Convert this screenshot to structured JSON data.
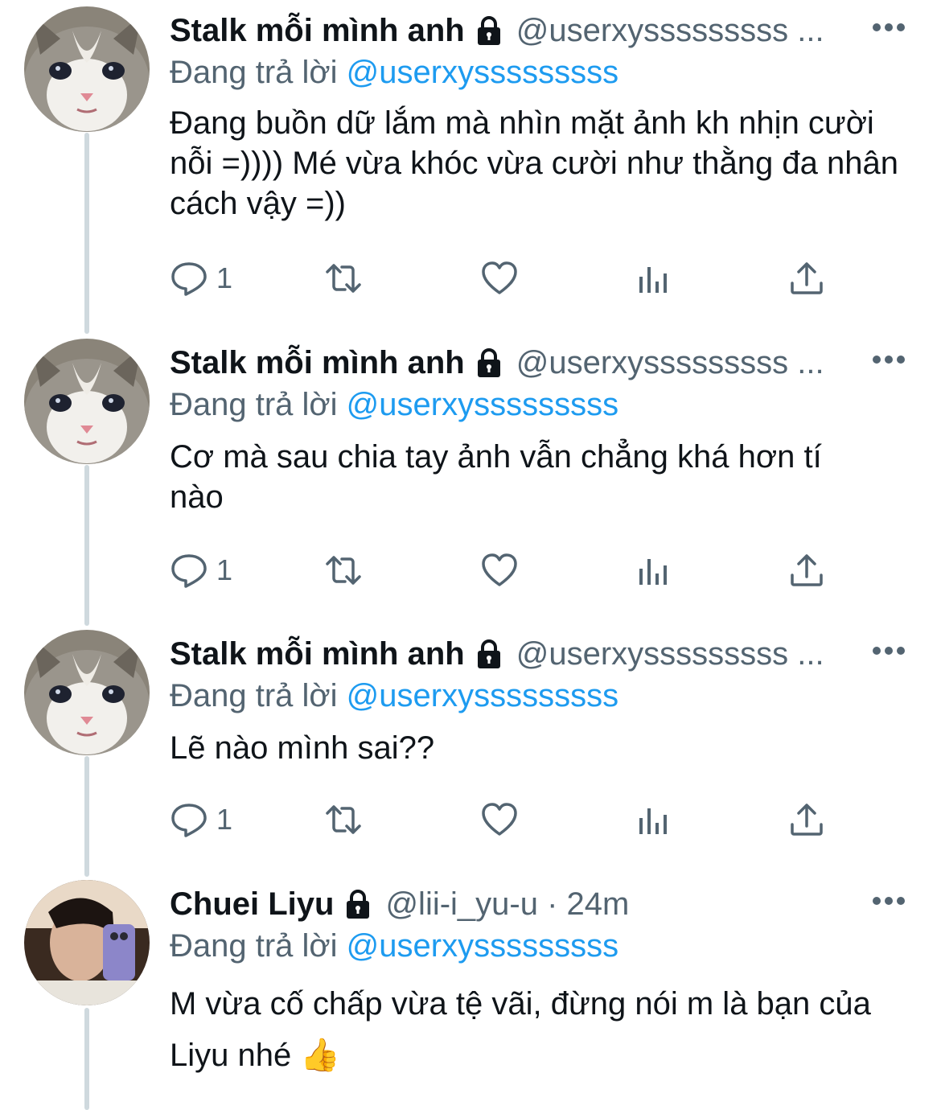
{
  "tweets": [
    {
      "name": "Stalk mỗi mình anh",
      "handle": "@userxysssssssss ...",
      "reply_prefix": "Đang trả lời",
      "reply_mention": "@userxysssssssss",
      "text": "Đang buồn dữ lắm mà nhìn mặt ảnh kh nhịn cười nỗi =)))) Mé vừa khóc vừa cười như thằng đa nhân cách vậy =))",
      "reply_count": "1"
    },
    {
      "name": "Stalk mỗi mình anh",
      "handle": "@userxysssssssss ...",
      "reply_prefix": "Đang trả lời",
      "reply_mention": "@userxysssssssss",
      "text": "Cơ mà sau chia tay ảnh vẫn chẳng khá hơn tí nào",
      "reply_count": "1"
    },
    {
      "name": "Stalk mỗi mình anh",
      "handle": "@userxysssssssss ...",
      "reply_prefix": "Đang trả lời",
      "reply_mention": "@userxysssssssss",
      "text": "Lẽ nào mình sai??",
      "reply_count": "1"
    },
    {
      "name": "Chuei Liyu",
      "handle": "@lii-i_yu-u · 24m",
      "reply_prefix": "Đang trả lời",
      "reply_mention": "@userxysssssssss",
      "text": "M vừa cố chấp vừa tệ vãi, đừng nói m là bạn của Liyu nhé 👍"
    }
  ],
  "icons": {
    "reply": "reply-icon",
    "retweet": "retweet-icon",
    "like": "heart-icon",
    "views": "views-icon",
    "share": "share-icon",
    "lock": "lock-icon",
    "more": "more-icon"
  },
  "colors": {
    "text": "#0f1419",
    "secondary": "#536471",
    "link": "#1d9bf0",
    "thread_line": "#cfd9de"
  }
}
